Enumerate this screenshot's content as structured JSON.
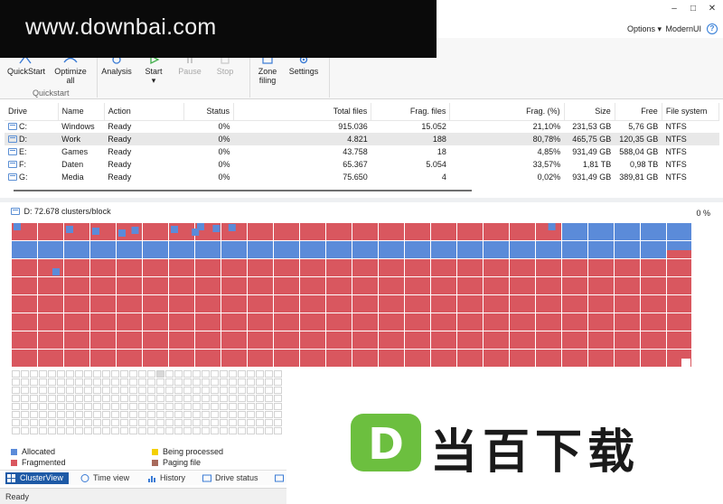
{
  "watermark": {
    "text": "www.downbai.com"
  },
  "window_controls": {
    "minimize": "–",
    "maximize": "□",
    "close": "✕"
  },
  "options_bar": {
    "options_label": "Options",
    "theme_label": "ModernUI",
    "help_label": "?"
  },
  "ribbon": {
    "quickstart_label": "QuickStart",
    "optimize_label_1": "Optimize",
    "optimize_label_2": "all",
    "group_label": "Quickstart",
    "analysis_label": "Analysis",
    "start_label": "Start",
    "pause_label": "Pause",
    "stop_label": "Stop",
    "zone_label_1": "Zone",
    "zone_label_2": "filing",
    "settings_label": "Settings"
  },
  "drive_table": {
    "columns": [
      "Drive",
      "Name",
      "Action",
      "Status",
      "Total files",
      "Frag. files",
      "Frag. (%)",
      "Size",
      "Free",
      "File system"
    ],
    "rows": [
      {
        "drive": "C:",
        "name": "Windows",
        "action": "Ready",
        "status": "0%",
        "total": "915.036",
        "frag_files": "15.052",
        "frag_pct": "21,10%",
        "size": "231,53 GB",
        "free": "5,76 GB",
        "fs": "NTFS"
      },
      {
        "drive": "D:",
        "name": "Work",
        "action": "Ready",
        "status": "0%",
        "total": "4.821",
        "frag_files": "188",
        "frag_pct": "80,78%",
        "size": "465,75 GB",
        "free": "120,35 GB",
        "fs": "NTFS"
      },
      {
        "drive": "E:",
        "name": "Games",
        "action": "Ready",
        "status": "0%",
        "total": "43.758",
        "frag_files": "18",
        "frag_pct": "4,85%",
        "size": "931,49 GB",
        "free": "588,04 GB",
        "fs": "NTFS"
      },
      {
        "drive": "F:",
        "name": "Daten",
        "action": "Ready",
        "status": "0%",
        "total": "65.367",
        "frag_files": "5.054",
        "frag_pct": "33,57%",
        "size": "1,81 TB",
        "free": "0,98 TB",
        "fs": "NTFS"
      },
      {
        "drive": "G:",
        "name": "Media",
        "action": "Ready",
        "status": "0%",
        "total": "75.650",
        "frag_files": "4",
        "frag_pct": "0,02%",
        "size": "931,49 GB",
        "free": "389,81 GB",
        "fs": "NTFS"
      }
    ],
    "selected_row": 1
  },
  "cluster_view": {
    "header": "D: 72.678 clusters/block",
    "progress": "0 %",
    "colors": {
      "allocated": "#5b8bd9",
      "fragmented": "#d9575f",
      "processing": "#f4d000",
      "paging": "#a86a5c",
      "empty_border": "#c8c8c8"
    }
  },
  "legend": {
    "allocated": "Allocated",
    "fragmented": "Fragmented",
    "processing": "Being processed",
    "paging": "Paging file"
  },
  "tabs": [
    {
      "label": "ClusterView",
      "active": true
    },
    {
      "label": "Time view",
      "active": false
    },
    {
      "label": "History",
      "active": false
    },
    {
      "label": "Drive status",
      "active": false
    }
  ],
  "status": {
    "text": "Ready"
  },
  "brand": {
    "text": "当百下载",
    "badge_letter": "D"
  }
}
